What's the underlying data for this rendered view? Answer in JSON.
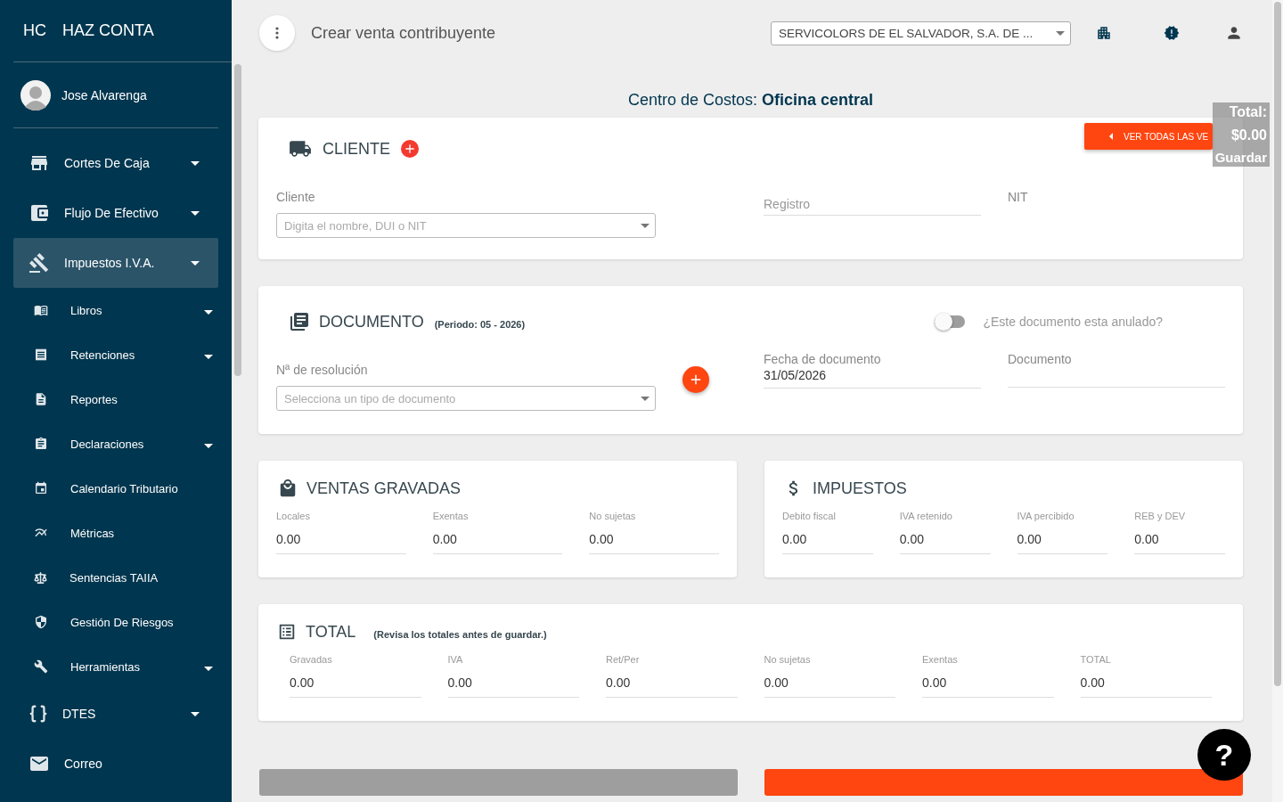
{
  "brand": {
    "logo": "HC",
    "name": "HAZ CONTA"
  },
  "user": {
    "name": "Jose Alvarenga"
  },
  "sidebar": {
    "items": [
      {
        "label": "Cortes De Caja",
        "selected": false,
        "expandable": true
      },
      {
        "label": "Flujo De Efectivo",
        "selected": false,
        "expandable": true
      },
      {
        "label": "Impuestos I.V.A.",
        "selected": true,
        "expandable": true,
        "children": [
          {
            "label": "Libros",
            "selected": false,
            "expandable": true
          },
          {
            "label": "Retenciones",
            "selected": false,
            "expandable": true
          },
          {
            "label": "Reportes",
            "selected": false,
            "expandable": false
          },
          {
            "label": "Declaraciones",
            "selected": false,
            "expandable": true
          },
          {
            "label": "Calendario Tributario",
            "selected": false,
            "expandable": false
          },
          {
            "label": "Métricas",
            "selected": false,
            "expandable": false
          },
          {
            "label": "Sentencias TAIIA",
            "selected": false,
            "expandable": false
          },
          {
            "label": "Gestión De Riesgos",
            "selected": false,
            "expandable": false
          },
          {
            "label": "Herramientas",
            "selected": false,
            "expandable": true
          }
        ]
      },
      {
        "label": "DTES",
        "selected": false,
        "expandable": true
      },
      {
        "label": "Correo",
        "selected": false,
        "expandable": false
      }
    ]
  },
  "header": {
    "title": "Crear venta contribuyente",
    "company_select": {
      "value": "SERVICOLORS DE EL SALVADOR, S.A. DE ..."
    }
  },
  "cost_center": "Centro de Costos: **Oficina central**",
  "view_all_button": "VER TODAS LAS VE",
  "floating_total": {
    "label": "Total:",
    "amount": "$0.00",
    "action": "Guardar"
  },
  "cliente": {
    "title": "CLIENTE",
    "client_field": {
      "label": "Cliente",
      "placeholder": "Digita el nombre, DUI o NIT"
    },
    "registro": {
      "placeholder": "Registro"
    },
    "nit": {
      "label": "NIT"
    }
  },
  "documento": {
    "title": "DOCUMENTO",
    "period": "(Periodo: 05 - 2026)",
    "annulled": {
      "label": "¿Este documento esta anulado?",
      "on": false
    },
    "resolution": {
      "label": "Nª de resolución",
      "placeholder": "Selecciona un tipo de documento"
    },
    "date": {
      "label": "Fecha de documento",
      "value": "31/05/2026"
    },
    "document": {
      "label": "Documento"
    }
  },
  "ventas": {
    "title": "VENTAS GRAVADAS",
    "fields": [
      {
        "label": "Locales",
        "value": "0.00"
      },
      {
        "label": "Exentas",
        "value": "0.00"
      },
      {
        "label": "No sujetas",
        "value": "0.00"
      }
    ]
  },
  "impuestos": {
    "title": "IMPUESTOS",
    "fields": [
      {
        "label": "Debito fiscal",
        "value": "0.00"
      },
      {
        "label": "IVA retenido",
        "value": "0.00"
      },
      {
        "label": "IVA percibido",
        "value": "0.00"
      },
      {
        "label": "REB y DEV",
        "value": "0.00"
      }
    ]
  },
  "total": {
    "title": "TOTAL",
    "note": "(Revisa los totales antes de guardar.)",
    "fields": [
      {
        "label": "Gravadas",
        "value": "0.00"
      },
      {
        "label": "IVA",
        "value": "0.00"
      },
      {
        "label": "Ret/Per",
        "value": "0.00"
      },
      {
        "label": "No sujetas",
        "value": "0.00"
      },
      {
        "label": "Exentas",
        "value": "0.00"
      },
      {
        "label": "TOTAL",
        "value": "0.00"
      }
    ]
  },
  "help_button": "?"
}
